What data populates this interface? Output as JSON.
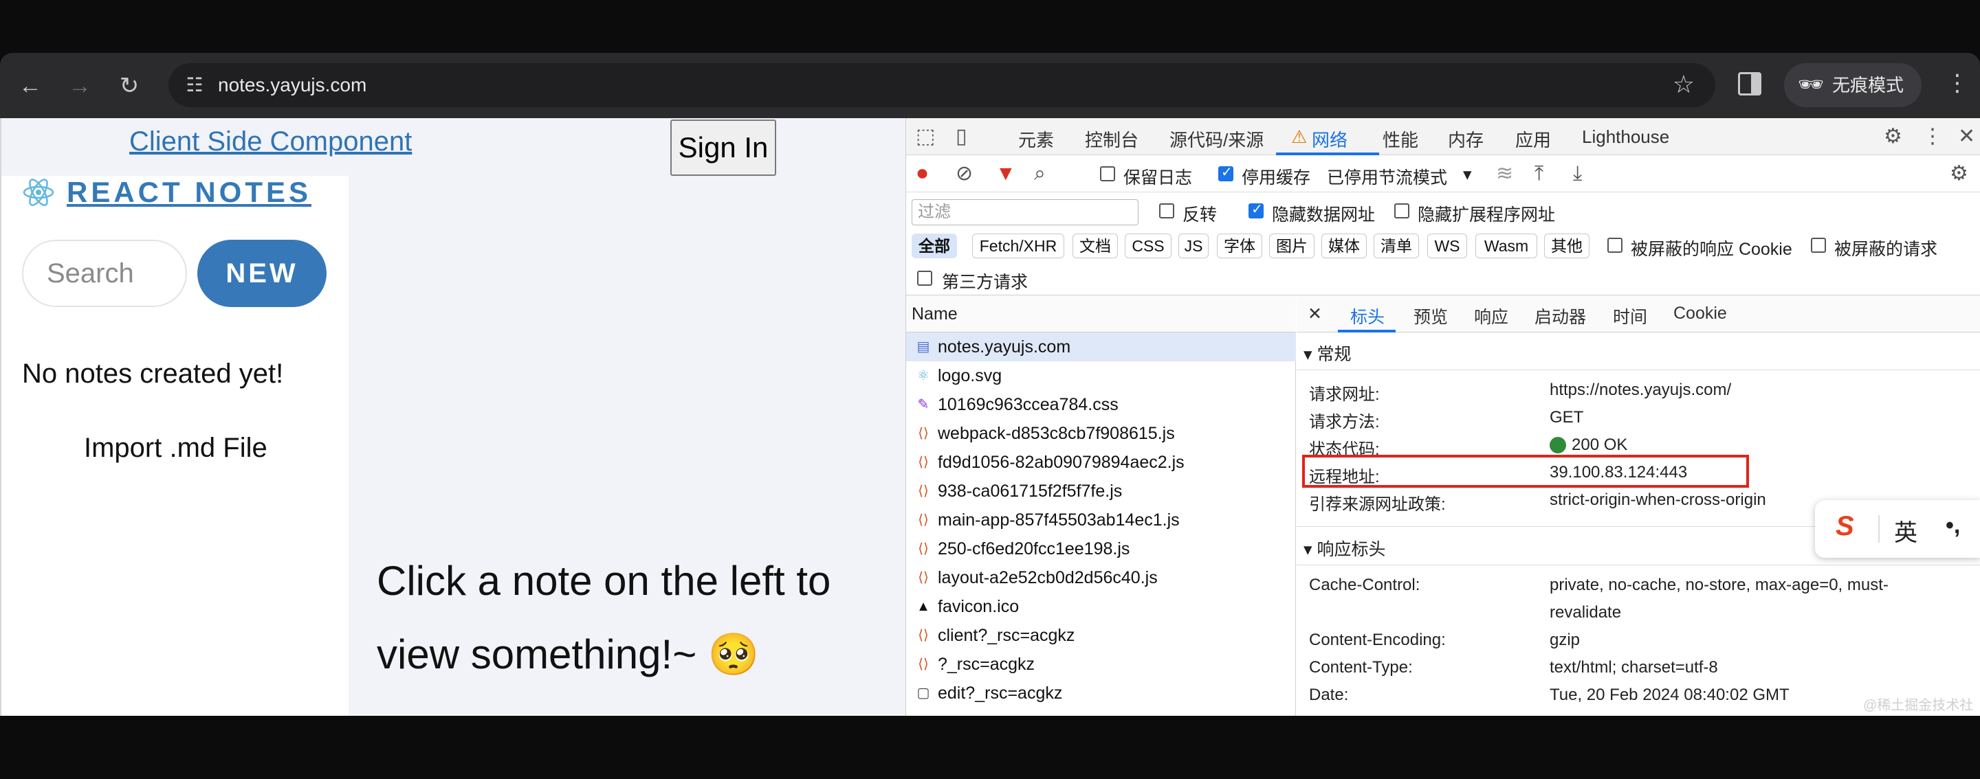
{
  "browser": {
    "url": "notes.yayujs.com",
    "incognito_label": "无痕模式"
  },
  "page": {
    "title_link": "Client Side Component",
    "signin_label": "Sign In",
    "brand": "REACT NOTES",
    "search_placeholder": "Search",
    "new_label": "NEW",
    "empty_text": "No notes created yet!",
    "import_label": "Import .md File",
    "placeholder_text": "Click a note on the left to view something!~ 🥺"
  },
  "devtools": {
    "tabs": [
      "元素",
      "控制台",
      "源代码/来源",
      "网络",
      "性能",
      "内存",
      "应用",
      "Lighthouse"
    ],
    "active_tab": "网络",
    "toolbar": {
      "preserve_log": "保留日志",
      "disable_cache": "停用缓存",
      "throttle": "已停用节流模式"
    },
    "filter": {
      "placeholder": "过滤",
      "invert": "反转",
      "hide_data_urls": "隐藏数据网址",
      "hide_ext_urls": "隐藏扩展程序网址"
    },
    "types": [
      "全部",
      "Fetch/XHR",
      "文档",
      "CSS",
      "JS",
      "字体",
      "图片",
      "媒体",
      "清单",
      "WS",
      "Wasm",
      "其他"
    ],
    "blocked_cookies": "被屏蔽的响应 Cookie",
    "blocked_requests": "被屏蔽的请求",
    "third_party": "第三方请求",
    "list_header": "Name",
    "requests": [
      {
        "name": "notes.yayujs.com",
        "icon": "▤"
      },
      {
        "name": "logo.svg",
        "icon": "⚛"
      },
      {
        "name": "10169c963ccea784.css",
        "icon": "✎"
      },
      {
        "name": "webpack-d853c8cb7f908615.js",
        "icon": "⟨⟩"
      },
      {
        "name": "fd9d1056-82ab09079894aec2.js",
        "icon": "⟨⟩"
      },
      {
        "name": "938-ca061715f2f5f7fe.js",
        "icon": "⟨⟩"
      },
      {
        "name": "main-app-857f45503ab14ec1.js",
        "icon": "⟨⟩"
      },
      {
        "name": "250-cf6ed20fcc1ee198.js",
        "icon": "⟨⟩"
      },
      {
        "name": "layout-a2e52cb0d2d56c40.js",
        "icon": "⟨⟩"
      },
      {
        "name": "favicon.ico",
        "icon": "▲"
      },
      {
        "name": "client?_rsc=acgkz",
        "icon": "⟨⟩"
      },
      {
        "name": "?_rsc=acgkz",
        "icon": "⟨⟩"
      },
      {
        "name": "edit?_rsc=acgkz",
        "icon": "▢"
      }
    ],
    "detail_tabs": [
      "标头",
      "预览",
      "响应",
      "启动器",
      "时间",
      "Cookie"
    ],
    "general_title": "常规",
    "general": {
      "url_k": "请求网址:",
      "url_v": "https://notes.yayujs.com/",
      "method_k": "请求方法:",
      "method_v": "GET",
      "status_k": "状态代码:",
      "status_v": "200 OK",
      "remote_k": "远程地址:",
      "remote_v": "39.100.83.124:443",
      "policy_k": "引荐来源网址政策:",
      "policy_v": "strict-origin-when-cross-origin"
    },
    "resp_title": "响应标头",
    "resp": {
      "cc_k": "Cache-Control:",
      "cc_v1": "private, no-cache, no-store, max-age=0, must-",
      "cc_v2": "revalidate",
      "ce_k": "Content-Encoding:",
      "ce_v": "gzip",
      "ct_k": "Content-Type:",
      "ct_v": "text/html; charset=utf-8",
      "date_k": "Date:",
      "date_v": "Tue, 20 Feb 2024 08:40:02 GMT"
    }
  },
  "ime": {
    "lang": "英",
    "punct": "•,"
  },
  "watermark": "@稀土掘金技术社区"
}
